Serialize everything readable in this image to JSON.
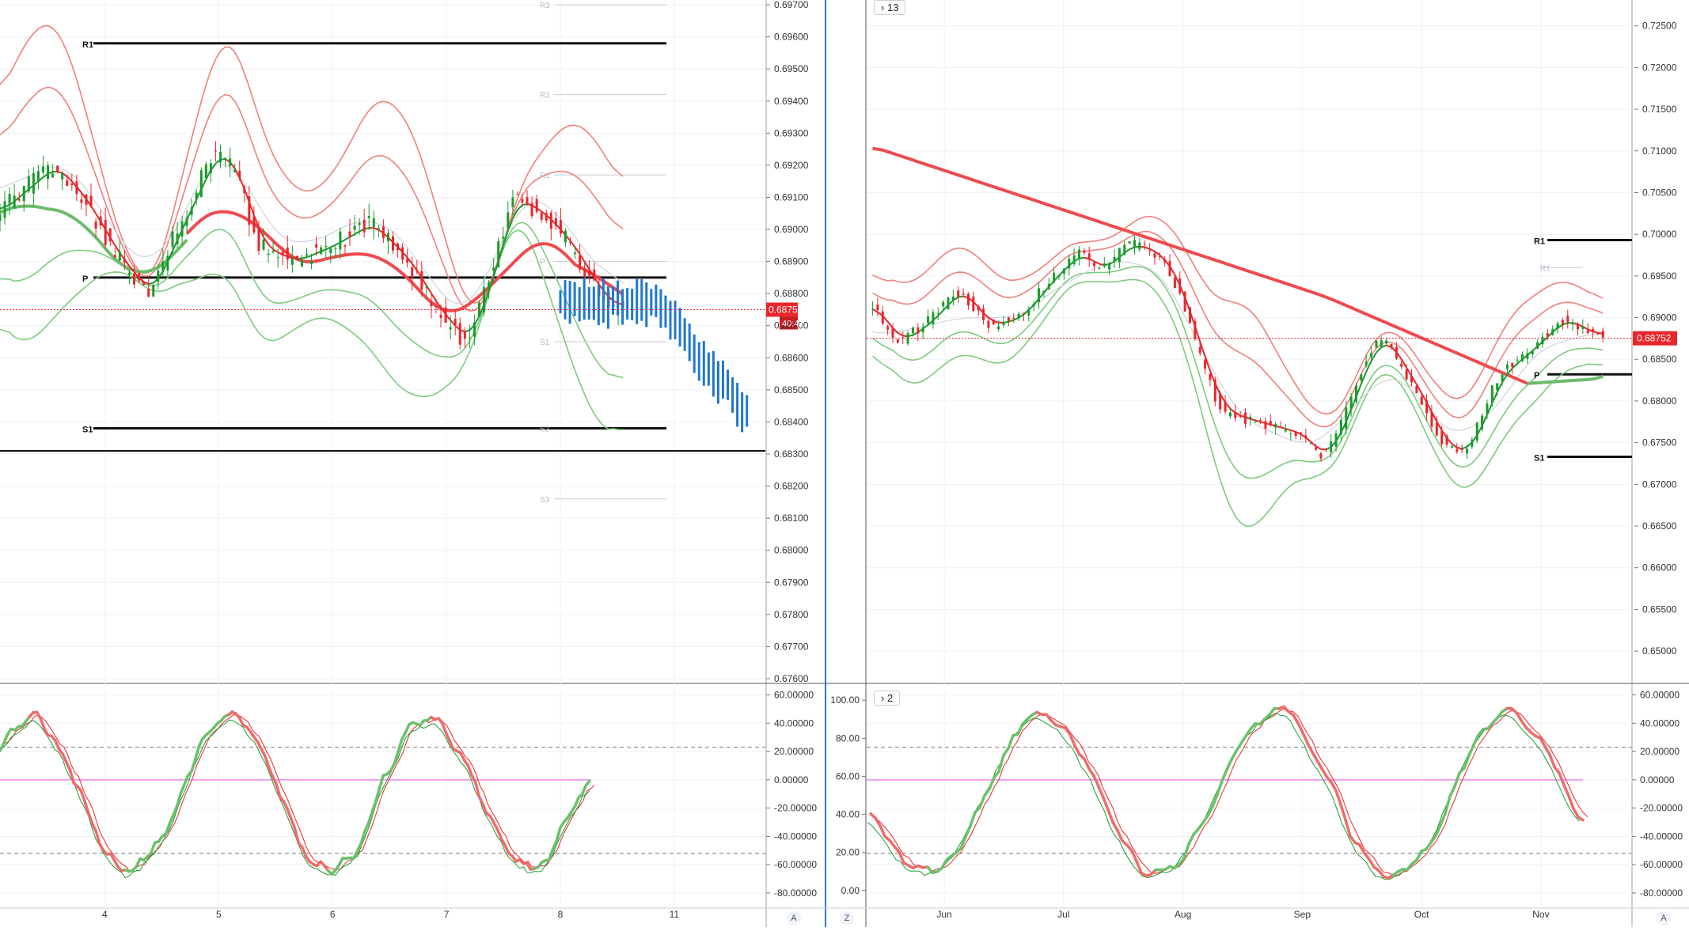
{
  "left_chart": {
    "price_axis": [
      "0.69700",
      "0.69600",
      "0.69500",
      "0.69400",
      "0.69300",
      "0.69200",
      "0.69100",
      "0.69000",
      "0.68900",
      "0.68800",
      "0.68700",
      "0.68600",
      "0.68500",
      "0.68400",
      "0.68300",
      "0.68200",
      "0.68100",
      "0.68000",
      "0.67900",
      "0.67800",
      "0.67700",
      "0.67600"
    ],
    "price_range": [
      0.67595,
      0.69715
    ],
    "time_labels": [
      {
        "t": 1,
        "label": "4"
      },
      {
        "t": 2,
        "label": "5"
      },
      {
        "t": 3,
        "label": "6"
      },
      {
        "t": 4,
        "label": "7"
      },
      {
        "t": 5,
        "label": "8"
      },
      {
        "t": 6,
        "label": "11"
      }
    ],
    "time_range": [
      0.08,
      6.8
    ],
    "last_price": "0.68750",
    "last_price_value": 0.6875,
    "countdown": "40:41",
    "pivot_levels": [
      {
        "label": "R1",
        "value": 0.6958
      },
      {
        "label": "P",
        "value": 0.6885
      },
      {
        "label": "S1",
        "value": 0.6838
      }
    ],
    "black_line_value": 0.6831,
    "faint_levels": [
      {
        "label": "R3",
        "value": 0.697
      },
      {
        "label": "R2",
        "value": 0.6942
      },
      {
        "label": "R1",
        "value": 0.6917
      },
      {
        "label": "P",
        "value": 0.689
      },
      {
        "label": "S1",
        "value": 0.6865
      },
      {
        "label": "S2",
        "value": 0.6838
      },
      {
        "label": "S3",
        "value": 0.6816
      }
    ],
    "oscillator": {
      "labels": [
        "60.00000",
        "40.00000",
        "20.00000",
        "0.00000",
        "-20.00000",
        "-40.00000",
        "-60.00000",
        "-80.00000"
      ],
      "range": [
        -89,
        67
      ],
      "upper_dashed": 23,
      "lower_dashed": -52,
      "zero_line": 0
    },
    "axis_button": "A"
  },
  "right_chart": {
    "legend": "13",
    "price_axis": [
      "0.72500",
      "0.72000",
      "0.71500",
      "0.71000",
      "0.70500",
      "0.70000",
      "0.69500",
      "0.69000",
      "0.68500",
      "0.68000",
      "0.67500",
      "0.67000",
      "0.66500",
      "0.66000",
      "0.65500",
      "0.65000"
    ],
    "price_range": [
      0.6465,
      0.7281
    ],
    "time_labels": [
      {
        "t": 1.1,
        "label": "Jun"
      },
      {
        "t": 2.1,
        "label": "Jul"
      },
      {
        "t": 3.1,
        "label": "Aug"
      },
      {
        "t": 4.1,
        "label": "Sep"
      },
      {
        "t": 5.1,
        "label": "Oct"
      },
      {
        "t": 6.1,
        "label": "Nov"
      }
    ],
    "time_range": [
      0.45,
      6.85
    ],
    "last_price": "0.68752",
    "last_price_value": 0.68752,
    "pivot_levels": [
      {
        "label": "R1",
        "value": 0.6993
      },
      {
        "label": "P",
        "value": 0.6832
      },
      {
        "label": "S1",
        "value": 0.6733
      }
    ],
    "faint_levels": [
      {
        "label": "R1",
        "value": 0.696
      }
    ],
    "oscillator": {
      "legend": "2",
      "left_labels": [
        "100.00",
        "80.00",
        "60.00",
        "40.00",
        "20.00",
        "0.00"
      ],
      "right_labels": [
        "60.00000",
        "40.00000",
        "20.00000",
        "0.00000",
        "-20.00000",
        "-40.00000",
        "-60.00000",
        "-80.00000"
      ],
      "range": [
        -89,
        67
      ],
      "left_range": [
        -8,
        108
      ],
      "upper_dashed": 23,
      "lower_dashed": -52,
      "pink_line": 0
    },
    "axis_buttons": {
      "left": "Z",
      "right": "A"
    }
  },
  "colors": {
    "bull": "#1b9a2e",
    "bear": "#e8262b",
    "band_red": "#f0807a",
    "band_green": "#7ccb7e",
    "ma_thick_red": "#ee4b4f",
    "ma_thick_green": "#6dbb6b",
    "forecast_blue": "#1f77d0",
    "pink": "#ee88ee",
    "grid": "#eef1f6",
    "divider": "#2c79c8"
  }
}
